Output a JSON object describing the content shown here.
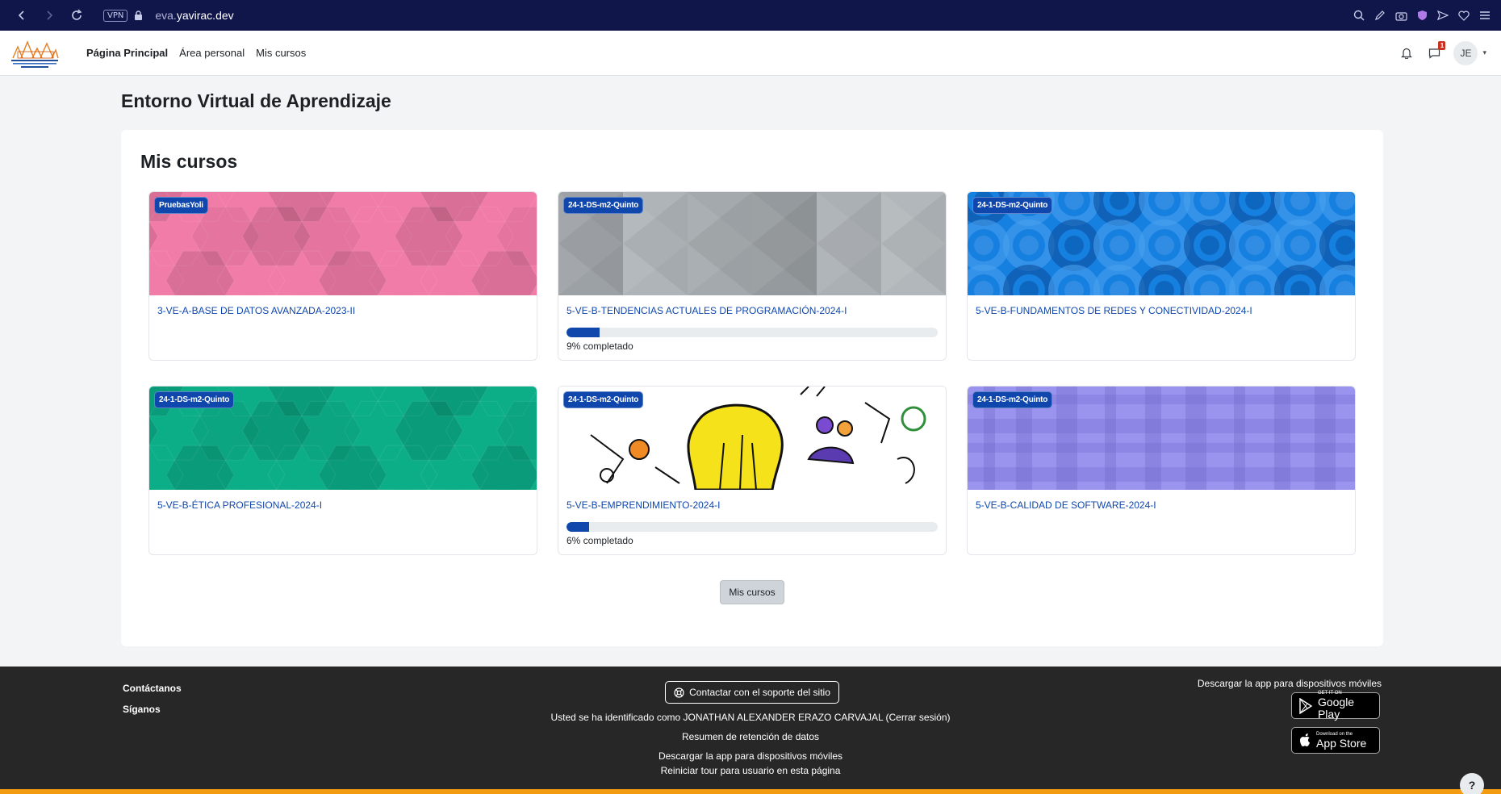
{
  "browser": {
    "vpn_label": "VPN",
    "url_prefix": "eva.",
    "url_domain": "yavirac.dev",
    "icons": [
      "back-icon",
      "forward-icon",
      "reload-icon",
      "lock-icon",
      "search-icon",
      "edit-icon",
      "camera-icon",
      "shield-icon",
      "send-icon",
      "heart-icon",
      "menu-icon"
    ]
  },
  "navbar": {
    "links": [
      "Página Principal",
      "Área personal",
      "Mis cursos"
    ],
    "notification_count": "1",
    "avatar_initials": "JE"
  },
  "page": {
    "title": "Entorno Virtual de Aprendizaje"
  },
  "mycourses": {
    "title": "Mis cursos",
    "button_label": "Mis cursos",
    "courses": [
      {
        "category": "PruebasYoli",
        "name": "3-VE-A-BASE DE DATOS AVANZADA-2023-II",
        "progress": null,
        "progress_text": "",
        "pattern": "hex",
        "color": "#f27ca8"
      },
      {
        "category": "24-1-DS-m2-Quinto",
        "name": "5-VE-B-TENDENCIAS ACTUALES DE PROGRAMACIÓN-2024-I",
        "progress": 0.09,
        "progress_text": "9% completado",
        "pattern": "triangles",
        "color": "#aeb4b8"
      },
      {
        "category": "24-1-DS-m2-Quinto",
        "name": "5-VE-B-FUNDAMENTOS DE REDES Y CONECTIVIDAD-2024-I",
        "progress": null,
        "progress_text": "",
        "pattern": "circles",
        "color": "#1580e0"
      },
      {
        "category": "24-1-DS-m2-Quinto",
        "name": "5-VE-B-ÉTICA PROFESIONAL-2024-I",
        "progress": null,
        "progress_text": "",
        "pattern": "hex",
        "color": "#0cae88"
      },
      {
        "category": "24-1-DS-m2-Quinto",
        "name": "5-VE-B-EMPRENDIMIENTO-2024-I",
        "progress": 0.06,
        "progress_text": "6% completado",
        "pattern": "sketch",
        "color": "#ffffff"
      },
      {
        "category": "24-1-DS-m2-Quinto",
        "name": "5-VE-B-CALIDAD DE SOFTWARE-2024-I",
        "progress": null,
        "progress_text": "",
        "pattern": "plaid",
        "color": "#9b94ef"
      }
    ]
  },
  "footer": {
    "contact": "Contáctanos",
    "follow": "Síganos",
    "support_button": "Contactar con el soporte del sitio",
    "logged_in_text": "Usted se ha identificado como JONATHAN ALEXANDER ERAZO CARVAJAL (Cerrar sesión)",
    "data_retention": "Resumen de retención de datos",
    "app_link": "Descargar la app para dispositivos móviles",
    "tour_reset": "Reiniciar tour para usuario en esta página",
    "app_title": "Descargar la app para dispositivos móviles",
    "google_small": "GET IT ON",
    "google_big": "Google Play",
    "apple_small": "Download on the",
    "apple_big": "App Store"
  },
  "help_label": "?"
}
